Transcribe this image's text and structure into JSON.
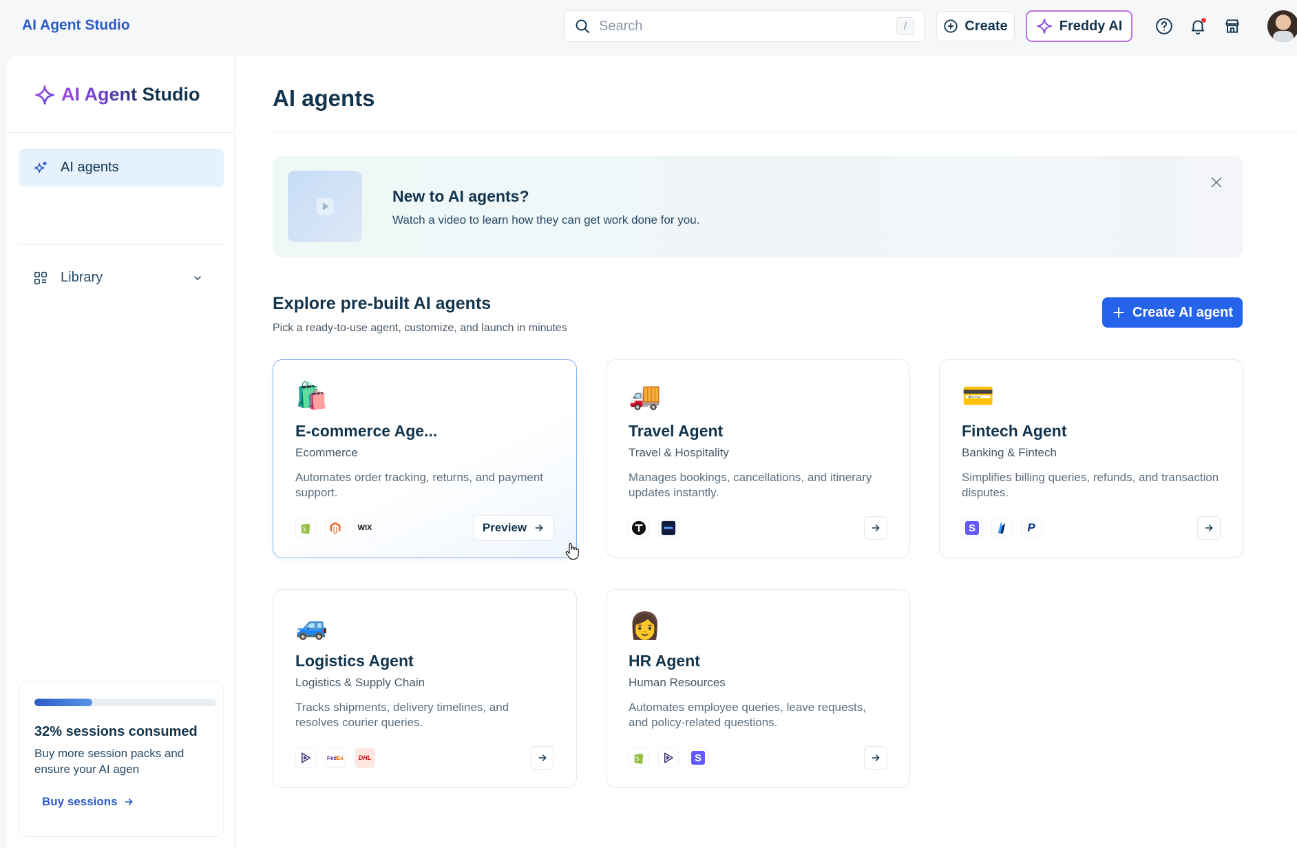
{
  "topbar": {
    "app_title": "AI Agent Studio",
    "search_placeholder": "Search",
    "search_shortcut": "/",
    "create_label": "Create",
    "freddy_label": "Freddy AI"
  },
  "sidebar": {
    "brand": "AI Agent Studio",
    "nav_active": "AI agents",
    "nav_library": "Library",
    "session": {
      "progress_percent": 32,
      "title": "32% sessions consumed",
      "description": "Buy more session packs and ensure your AI agen",
      "buy_label": "Buy sessions"
    }
  },
  "main": {
    "page_title": "AI agents",
    "banner": {
      "title": "New to AI agents?",
      "description": "Watch a video to learn how they can get work done for you."
    },
    "section": {
      "title": "Explore pre-built AI agents",
      "description": "Pick a ready-to-use agent, customize, and launch in minutes",
      "create_label": "Create AI agent"
    },
    "cards": [
      {
        "emoji": "🛍️",
        "title": "E-commerce Age...",
        "category": "Ecommerce",
        "description": "Automates order tracking, returns, and payment support.",
        "integrations": [
          "shopify-icon",
          "magento-icon",
          "wix-icon"
        ],
        "integration_labels": [
          "",
          "",
          "WIX"
        ],
        "preview_label": "Preview"
      },
      {
        "emoji": "🚚",
        "title": "Travel Agent",
        "category": "Travel & Hospitality",
        "description": "Manages bookings, cancellations, and itinerary updates instantly.",
        "integrations": [
          "tripadvisor-icon",
          "booking-icon"
        ],
        "integration_labels": [
          "",
          ""
        ]
      },
      {
        "emoji": "💳",
        "title": "Fintech Agent",
        "category": "Banking & Fintech",
        "description": "Simplifies billing queries, refunds, and transaction disputes.",
        "integrations": [
          "stripe-icon",
          "razorpay-icon",
          "paypal-icon"
        ],
        "integration_labels": [
          "S",
          "",
          "P"
        ]
      },
      {
        "emoji": "🚙",
        "title": "Logistics Agent",
        "category": "Logistics & Supply Chain",
        "description": "Tracks shipments, delivery timelines, and resolves courier queries.",
        "integrations": [
          "shipway-icon",
          "fedex-icon",
          "dhl-icon"
        ],
        "integration_labels": [
          "",
          "FedEx",
          "DHL"
        ]
      },
      {
        "emoji": "👩",
        "title": "HR Agent",
        "category": "Human Resources",
        "description": "Automates employee queries, leave requests, and policy-related questions.",
        "integrations": [
          "shopify-icon",
          "shipway-icon",
          "stripe-icon"
        ],
        "integration_labels": [
          "",
          "",
          "S"
        ]
      }
    ]
  },
  "colors": {
    "accent": "#2c5cc5",
    "primary_button": "#2563eb",
    "freddy_border": "#b873e6",
    "active_nav_bg": "#e5f1fd"
  }
}
